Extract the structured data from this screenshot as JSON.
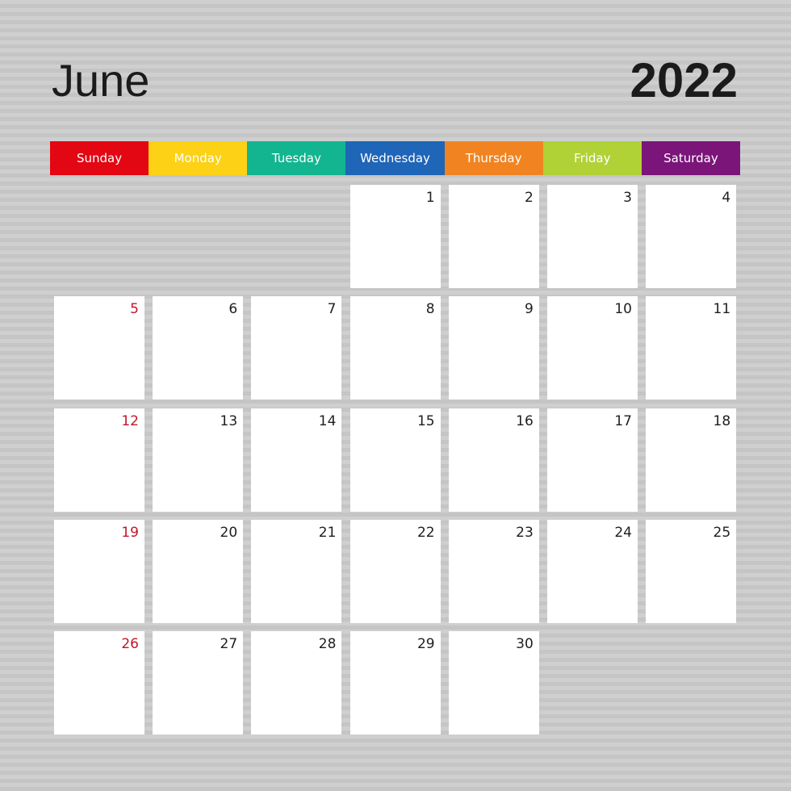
{
  "calendar": {
    "month": "June",
    "year": "2022",
    "first_weekday_index": 3,
    "days_in_month": 30,
    "weekend_number_color": "#c0162a",
    "weekdays": [
      {
        "label": "Sunday",
        "color": "#e30613"
      },
      {
        "label": "Monday",
        "color": "#fcd116"
      },
      {
        "label": "Tuesday",
        "color": "#12b590"
      },
      {
        "label": "Wednesday",
        "color": "#1f65b8"
      },
      {
        "label": "Thursday",
        "color": "#f18421"
      },
      {
        "label": "Friday",
        "color": "#b0d236"
      },
      {
        "label": "Saturday",
        "color": "#7b157a"
      }
    ],
    "dates": [
      "1",
      "2",
      "3",
      "4",
      "5",
      "6",
      "7",
      "8",
      "9",
      "10",
      "11",
      "12",
      "13",
      "14",
      "15",
      "16",
      "17",
      "18",
      "19",
      "20",
      "21",
      "22",
      "23",
      "24",
      "25",
      "26",
      "27",
      "28",
      "29",
      "30"
    ]
  }
}
